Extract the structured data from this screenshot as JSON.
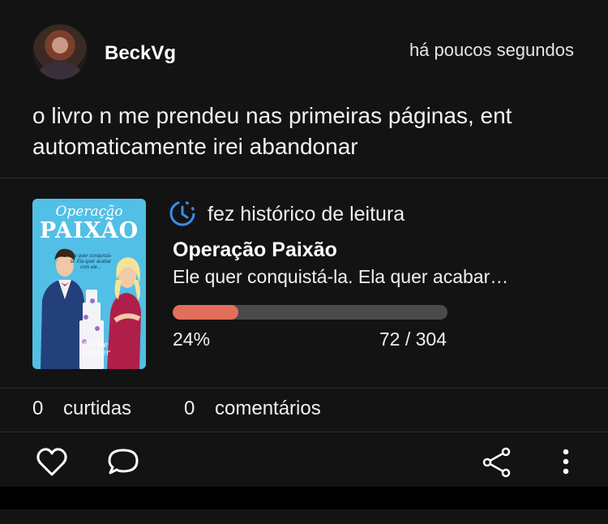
{
  "post": {
    "username": "BeckVg",
    "timestamp": "há poucos segundos",
    "text": "o livro n me prendeu nas primeiras páginas, ent automaticamente irei abandonar"
  },
  "activity": {
    "icon": "history-icon",
    "label": "fez histórico de leitura",
    "accent_color": "#3a8ee6"
  },
  "book": {
    "title": "Operação Paixão",
    "description": "Ele quer conquistá-la. Ela quer acabar…",
    "cover": {
      "title_line1": "Operação",
      "title_line2": "PAIXÃO",
      "tagline": "Ele quer conquistá-la. Ela quer acabar com ele...",
      "author": "Carlie Walker"
    }
  },
  "progress": {
    "fraction": 0.24,
    "percent_label": "24%",
    "pages_label": "72 / 304",
    "fill_color": "#e46e5c"
  },
  "stats": {
    "likes_count": "0",
    "likes_label": "curtidas",
    "comments_count": "0",
    "comments_label": "comentários"
  },
  "actions": [
    "heart-icon",
    "comment-icon",
    "share-icon",
    "more-vertical-icon"
  ]
}
